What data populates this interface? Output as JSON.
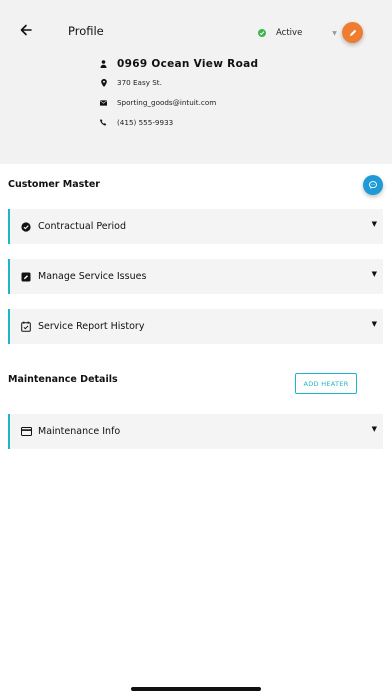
{
  "header": {
    "title": "Profile",
    "status_label": "Active",
    "status_color": "#3cb54a",
    "icons": {
      "back": "arrow-left-icon",
      "status": "check-circle-icon",
      "caret": "caret-down-icon",
      "edit": "pencil-icon"
    }
  },
  "contact": {
    "name": "0969 Ocean View Road",
    "address": "370 Easy St.",
    "email": "Sporting_goods@intuit.com",
    "phone": "(415) 555-9933",
    "icons": {
      "name": "person-icon",
      "address": "map-pin-icon",
      "email": "envelope-icon",
      "phone": "phone-icon"
    }
  },
  "customer_master": {
    "title": "Customer Master",
    "items": [
      {
        "label": "Contractual Period",
        "icon": "check-badge-icon"
      },
      {
        "label": "Manage Service Issues",
        "icon": "edit-square-icon"
      },
      {
        "label": "Service Report History",
        "icon": "calendar-check-icon"
      }
    ]
  },
  "maintenance": {
    "title": "Maintenance Details",
    "add_button": "ADD HEATER",
    "items": [
      {
        "label": "Maintenance Info",
        "icon": "credit-card-icon"
      }
    ]
  },
  "colors": {
    "accent": "#1fb5c9",
    "edit_fab": "#ee7d31",
    "chat_fab": "#1e9bd7",
    "header_bg": "#f2f2f2",
    "card_bg": "#f4f4f4"
  }
}
